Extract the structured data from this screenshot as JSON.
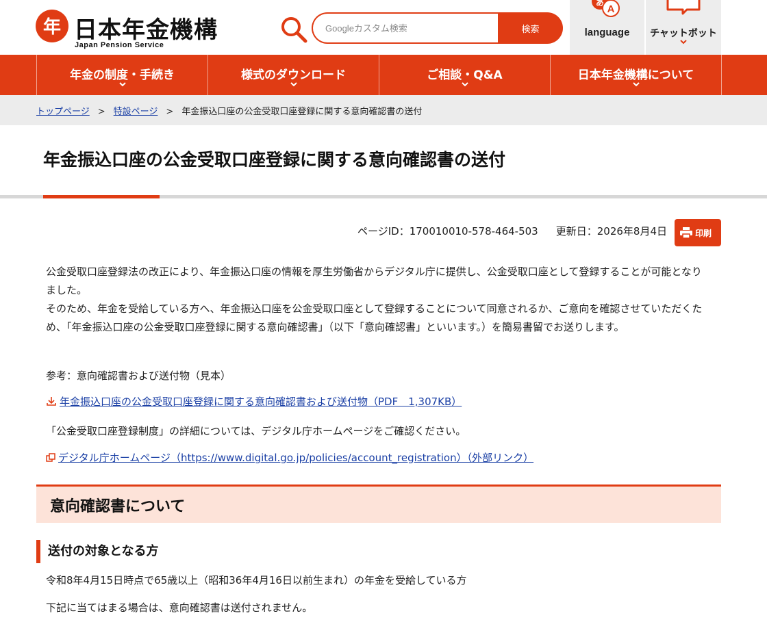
{
  "site": {
    "logo_title": "日本年金機構",
    "logo_subtitle": "Japan Pension Service"
  },
  "search": {
    "placeholder": "Googleカスタム検索",
    "button_label": "検索"
  },
  "utility": {
    "language_label": "language",
    "chatbot_label": "チャットボット"
  },
  "nav": {
    "items": [
      {
        "label": "年金の制度・手続き"
      },
      {
        "label": "様式のダウンロード"
      },
      {
        "label": "ご相談・Q&A"
      },
      {
        "label": "日本年金機構について"
      }
    ]
  },
  "breadcrumb": {
    "items": [
      "トップページ",
      "特設ページ"
    ],
    "separator": ">",
    "current": "年金振込口座の公金受取口座登録に関する意向確認書の送付"
  },
  "page": {
    "title": "年金振込口座の公金受取口座登録に関する意向確認書の送付",
    "page_id": "ページID：170010010-578-464-503",
    "updated": "更新日：2026年8月4日",
    "print_label": "印刷"
  },
  "content": {
    "intro": "公金受取口座登録法の改正により、年金振込口座の情報を厚生労働省からデジタル庁に提供し、公金受取口座として登録することが可能となりました。",
    "intro2": "そのため、年金を受給している方へ、年金振込口座を公金受取口座として登録することについて同意されるか、ご意向を確認させていただくため、「年金振込口座の公金受取口座登録に関する意向確認書」（以下「意向確認書」といいます。）を簡易書留でお送りします。",
    "reference": "参考：意向確認書および送付物（見本）",
    "pdf_link": "年金振込口座の公金受取口座登録に関する意向確認書および送付物（PDF　1,307KB）",
    "digital_note": "「公金受取口座登録制度」の詳細については、デジタル庁ホームページをご確認ください。",
    "external_link": "デジタル庁ホームページ（https://www.digital.go.jp/policies/account_registration）（外部リンク）",
    "section_heading": "意向確認書について",
    "subsection_heading": "送付の対象となる方",
    "target_text": "令和8年4月15日時点で65歳以上（昭和36年4月16日以前生まれ）の年金を受給している方",
    "exclusion_text": "下記に当てはまる場合は、意向確認書は送付されません。"
  },
  "colors": {
    "brand": "#e03c14",
    "link": "#1a3fa5",
    "section_bg": "#fde3d9",
    "breadcrumb_bg": "#ececec"
  },
  "icons": [
    "logo-emblem-icon",
    "search-icon",
    "language-icon",
    "chatbot-icon",
    "chevron-down-icon",
    "printer-icon",
    "pdf-download-icon",
    "external-link-icon"
  ]
}
